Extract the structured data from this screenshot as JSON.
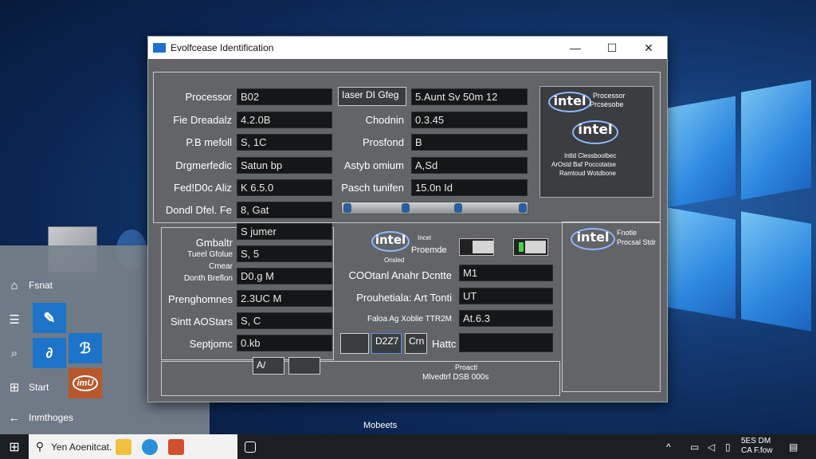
{
  "window": {
    "title": "Evolfcease Identification",
    "controls": {
      "minimize": "—",
      "maximize": "☐",
      "close": "✕"
    }
  },
  "left_fields": [
    {
      "label": "Processor",
      "value": "B02"
    },
    {
      "label": "Fie Dreadalz",
      "value": "4.2.0B"
    },
    {
      "label": "P.B mefoll",
      "value": "S, 1C"
    },
    {
      "label": "Drgmerfedic",
      "value": "Satun bp"
    },
    {
      "label": "Fed!D0c Aliz",
      "value": "K 6.5.0"
    },
    {
      "label": "Dondl Dfel. Fe",
      "value": "8, Gat"
    }
  ],
  "mid_fields": [
    {
      "label": "Chodnin",
      "value": "0.3.45"
    },
    {
      "label": "Prosfond",
      "value": "B"
    },
    {
      "label": "Astyb omium",
      "value": "A,Sd"
    },
    {
      "label": "Pasch tunifen",
      "value": "15.0n Id"
    }
  ],
  "mid_header_button": "Iaser DI Gfeg",
  "mid_header_value": "5.Aunt Sv 50m 12",
  "lower_left_fields": [
    {
      "label": "Gmbaltr",
      "value": "S jumer"
    },
    {
      "label": "Tueel Gfolue",
      "value": "S, 5"
    },
    {
      "label": "Donth Breflon",
      "value": "D0.g M"
    },
    {
      "label": "Prenghomnes",
      "value": "2.3UC M"
    },
    {
      "label": "Sintt AOStars",
      "value": "S, C"
    },
    {
      "label": "Septjomc",
      "value": "0.kb"
    }
  ],
  "lower_left_sublabels": [
    "Cmear"
  ],
  "lower_mid_fields": [
    {
      "label": "COOtanl Anahr Dcntte",
      "value": "M1"
    },
    {
      "label": "Prouhetiala: Art Tonti",
      "value": "UT"
    },
    {
      "label": "Faloa Ag Xoblie TTR2M",
      "value": "At.6.3"
    }
  ],
  "lower_mid_intel": {
    "logo": "intel",
    "top": "Incel",
    "mid": "Proemde",
    "bottom": "Onsled"
  },
  "lower_mid_buttons": {
    "b1": "D2Z7",
    "b2": "Crn",
    "label": "Hattc"
  },
  "bottom_buttons": {
    "b1": "A/",
    "b2": ""
  },
  "bottom_text": {
    "line1": "Proactl",
    "line2": "Mlvedtrf DSB 000s"
  },
  "intel_top": {
    "logo": "intel",
    "caption1": "Processor",
    "caption2": "Prcsesobe",
    "logo2": "intel",
    "fine1": "Intld Clessboolbec",
    "fine2": "ArOstd Baf Poccotatse",
    "fine3": "Ramtoud Wotdbone"
  },
  "intel_right": {
    "logo": "intel",
    "caption": "Fnotle Procsal Stdr"
  },
  "start_menu": {
    "items": [
      {
        "icon": "⌂",
        "label": "Fsnat"
      },
      {
        "icon": "☰",
        "label": ""
      },
      {
        "icon": "⌕",
        "label": ""
      },
      {
        "icon": "⊞",
        "label": "Start"
      },
      {
        "icon": "←",
        "label": "Inmthoges"
      }
    ],
    "orange_tile": "imU"
  },
  "desktop_label": "Mobeets",
  "taskbar": {
    "search_text": "Yen Aoenitcat.",
    "time": "5ES DM",
    "date": "CA F.fow"
  },
  "colors": {
    "field_bg": "#151617",
    "window_bg": "#626467",
    "accent": "#1d73c8"
  }
}
